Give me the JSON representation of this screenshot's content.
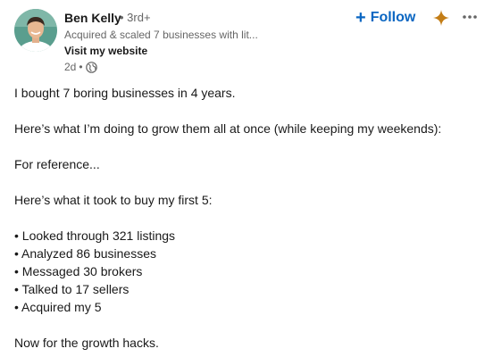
{
  "author": {
    "name": "Ben Kelly",
    "degree": "• 3rd+",
    "headline": "Acquired & scaled 7 businesses with lit...",
    "website_label": "Visit my website",
    "time_ago": "2d",
    "meta_separator": "•"
  },
  "actions": {
    "follow_plus": "+",
    "follow_label": "Follow"
  },
  "icons": {
    "avatar": "profile-photo",
    "visibility": "globe-icon",
    "sparkle": "sparkle-icon",
    "more": "ellipsis-icon"
  },
  "colors": {
    "link_blue": "#0a66c2",
    "sparkle": "#c37d16",
    "muted_text": "#666666",
    "text": "#191919"
  },
  "post": {
    "paragraphs": [
      [
        "I bought 7 boring businesses in 4 years."
      ],
      [
        "Here’s what I’m doing to grow them all at once (while keeping my weekends):"
      ],
      [
        "For reference..."
      ],
      [
        "Here’s what it took to buy my first 5:"
      ],
      [
        "• Looked through 321 listings",
        "• Analyzed 86 businesses",
        "• Messaged 30 brokers",
        "• Talked to 17 sellers",
        "• Acquired my 5"
      ],
      [
        "Now for the growth hacks."
      ]
    ]
  }
}
